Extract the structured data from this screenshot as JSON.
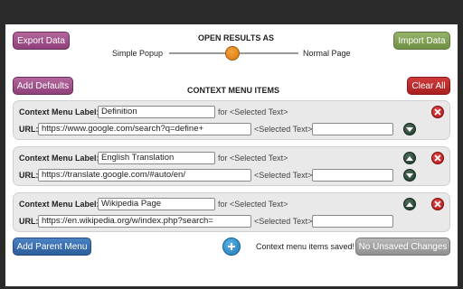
{
  "toolbar": {
    "export_label": "Export Data",
    "import_label": "Import Data",
    "open_results_heading": "OPEN RESULTS AS",
    "simple_popup_label": "Simple Popup",
    "normal_page_label": "Normal Page",
    "slider_value": 0.5
  },
  "context_menu": {
    "add_defaults_label": "Add Defaults",
    "heading": "CONTEXT MENU ITEMS",
    "clear_all_label": "Clear All",
    "label_caption": "Context Menu Label:",
    "url_caption": "URL:",
    "for_text": "for",
    "selected_text_placeholder": "<Selected Text>",
    "items": [
      {
        "label": "Definition",
        "url": "https://www.google.com/search?q=define+",
        "suffix": ""
      },
      {
        "label": "English Translation",
        "url": "https://translate.google.com/#auto/en/",
        "suffix": ""
      },
      {
        "label": "Wikipedia Page",
        "url": "https://en.wikipedia.org/w/index.php?search=",
        "suffix": ""
      }
    ]
  },
  "footer": {
    "add_parent_label": "Add Parent Menu",
    "add_icon": "plus-icon",
    "saved_status": "Context menu items saved!",
    "unsaved_label": "No Unsaved Changes"
  },
  "colors": {
    "purple": "#a0528a",
    "green": "#86a35a",
    "red": "#bf2b2b",
    "blue": "#3a70b0",
    "orange": "#e8890f"
  }
}
